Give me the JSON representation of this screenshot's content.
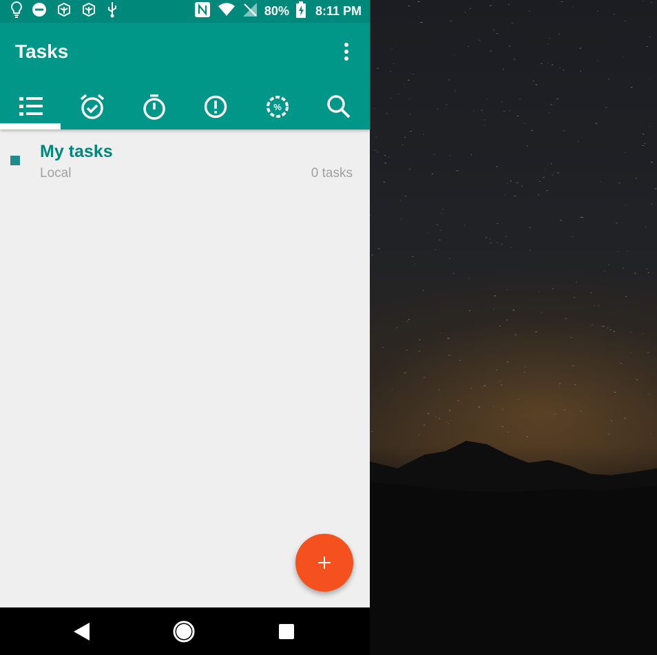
{
  "status_bar": {
    "battery": "80%",
    "time": "8:11 PM",
    "icons_left": [
      "lightbulb-icon",
      "do-not-disturb-icon",
      "app-icon",
      "app-icon",
      "usb-icon"
    ],
    "icons_right": [
      "nfc-icon",
      "wifi-icon",
      "no-signal-icon",
      "battery-charging-icon"
    ]
  },
  "app_bar": {
    "title": "Tasks",
    "menu_icon": "more-vert-icon",
    "tabs": [
      {
        "icon": "list-icon",
        "selected": true
      },
      {
        "icon": "alarm-check-icon",
        "selected": false
      },
      {
        "icon": "timer-icon",
        "selected": false
      },
      {
        "icon": "priority-icon",
        "selected": false
      },
      {
        "icon": "progress-percent-icon",
        "selected": false
      },
      {
        "icon": "search-icon",
        "selected": false
      }
    ]
  },
  "lists": [
    {
      "name": "My tasks",
      "account": "Local",
      "count": "0 tasks",
      "color": "#1f8b8c"
    }
  ],
  "fab": {
    "label": "+",
    "icon": "add-icon"
  },
  "nav_bar": {
    "icons": [
      "back-icon",
      "home-icon",
      "recents-icon"
    ]
  },
  "colors": {
    "primary": "#009688",
    "primary_dark": "#00897b",
    "accent": "#f4511e",
    "background": "#efefef"
  }
}
